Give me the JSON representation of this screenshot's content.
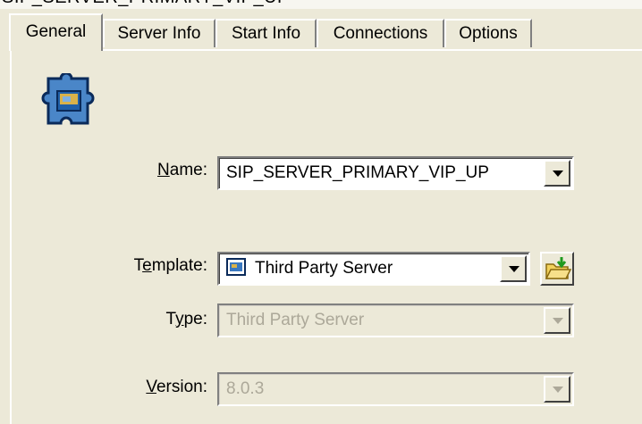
{
  "window": {
    "title": "SIP_SERVER_PRIMARY_VIP_UP"
  },
  "tabs": [
    {
      "label": "General",
      "active": true
    },
    {
      "label": "Server Info",
      "active": false
    },
    {
      "label": "Start Info",
      "active": false
    },
    {
      "label": "Connections",
      "active": false
    },
    {
      "label": "Options",
      "active": false
    }
  ],
  "form": {
    "name": {
      "label_prefix": "",
      "label_key": "N",
      "label_rest": "ame:",
      "value": "SIP_SERVER_PRIMARY_VIP_UP"
    },
    "template": {
      "label_prefix": "T",
      "label_key": "e",
      "label_rest": "mplate:",
      "value": "Third Party Server"
    },
    "type": {
      "label_prefix": "T",
      "label_key": "y",
      "label_rest": "pe:",
      "value": "Third Party Server"
    },
    "version": {
      "label_prefix": "",
      "label_key": "V",
      "label_rest": "ersion:",
      "value": "8.0.3"
    }
  },
  "icons": {
    "app": "application-server-icon",
    "template": "server-template-icon",
    "browse": "folder-browse-icon"
  }
}
